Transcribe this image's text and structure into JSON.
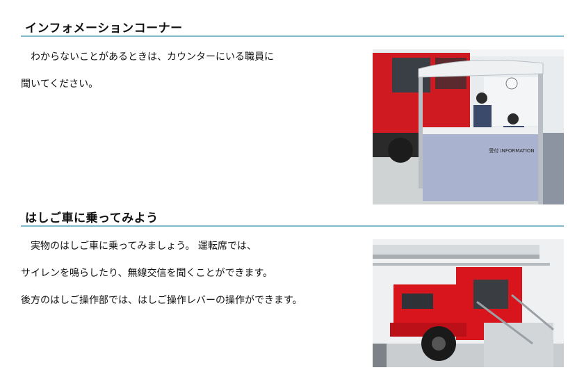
{
  "sections": [
    {
      "title": "インフォメーションコーナー",
      "lines": [
        "　わからないことがあるときは、カウンターにいる職員に",
        "聞いてください。"
      ],
      "photo_sign": "受付 INFORMATION"
    },
    {
      "title": "はしご車に乗ってみよう",
      "lines": [
        "　実物のはしご車に乗ってみましょう。 運転席では、",
        "サイレンを鳴らしたり、無線交信を聞くことができます。",
        "後方のはしご操作部では、はしご操作レバーの操作ができます。"
      ]
    }
  ],
  "colors": {
    "accent_rule": "#7fb9c9",
    "truck_red": "#d8141c"
  }
}
